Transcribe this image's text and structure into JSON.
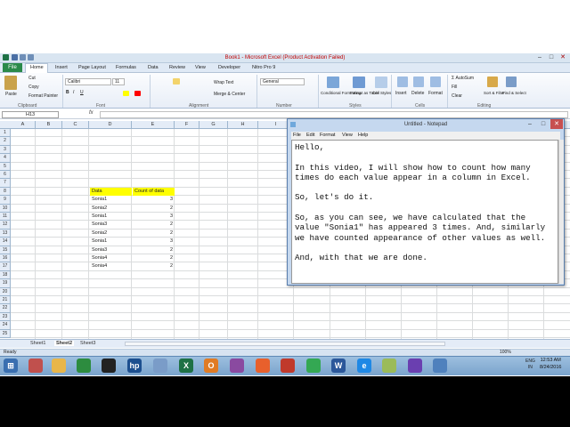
{
  "excel": {
    "title": "Book1 - Microsoft Excel (Product Activation Failed)",
    "tabs": [
      "File",
      "Home",
      "Insert",
      "Page Layout",
      "Formulas",
      "Data",
      "Review",
      "View",
      "Developer",
      "Nitro Pro 9"
    ],
    "ribbon": {
      "paste": "Paste",
      "cut": "Cut",
      "copy": "Copy",
      "format_painter": "Format Painter",
      "font_name": "Calibri",
      "font_size": "11",
      "wrap_text": "Wrap Text",
      "merge_center": "Merge & Center",
      "number_format": "General",
      "conditional_formatting": "Conditional Formatting",
      "format_as_table": "Format as Table",
      "cell_styles": "Cell Styles",
      "insert": "Insert",
      "delete": "Delete",
      "format": "Format",
      "autosum": "AutoSum",
      "fill": "Fill",
      "clear": "Clear",
      "sort_filter": "Sort & Filter",
      "find_select": "Find & Select",
      "groups": {
        "clipboard": "Clipboard",
        "font": "Font",
        "alignment": "Alignment",
        "number": "Number",
        "styles": "Styles",
        "cells": "Cells",
        "editing": "Editing"
      }
    },
    "name_box": "H13",
    "fx": "fx",
    "columns": [
      "A",
      "B",
      "C",
      "D",
      "E",
      "F",
      "G",
      "H",
      "I"
    ],
    "rows": [
      "1",
      "2",
      "3",
      "4",
      "5",
      "6",
      "7",
      "8",
      "9",
      "10",
      "11",
      "12",
      "13",
      "14",
      "15",
      "16",
      "17",
      "18",
      "19",
      "20",
      "21",
      "22",
      "23",
      "24",
      "25"
    ],
    "table": {
      "header": [
        "Data",
        "Count of data"
      ],
      "rows": [
        [
          "Sonia1",
          "3"
        ],
        [
          "Sonia2",
          "2"
        ],
        [
          "Sonia1",
          "3"
        ],
        [
          "Sonia3",
          "2"
        ],
        [
          "Sonia2",
          "2"
        ],
        [
          "Sonia1",
          "3"
        ],
        [
          "Sonia3",
          "2"
        ],
        [
          "Sonia4",
          "2"
        ],
        [
          "Sonia4",
          "2"
        ]
      ]
    },
    "sheets": [
      "Sheet1",
      "Sheet2",
      "Sheet3"
    ],
    "status": "Ready",
    "zoom": "100%",
    "colors": {
      "accent": "#1e7145",
      "header_fill": "#ffff00"
    }
  },
  "notepad": {
    "title": "Untitled - Notepad",
    "menu": [
      "File",
      "Edit",
      "Format",
      "View",
      "Help"
    ],
    "lines": [
      "Hello,",
      "",
      "In this video, I will show how to count how many",
      "times do each value appear in a column in Excel.",
      "",
      "So, let's do it.",
      "",
      "So, as you can see, we have calculated that the",
      "value \"Sonia1\" has appeared 3 times. And, similarly",
      "we have counted appearance of other values as well.",
      "",
      "And, with that we are done."
    ]
  },
  "taskbar": {
    "lang": "ENG",
    "region": "IN",
    "time": "12:53 AM",
    "date": "8/24/2016"
  }
}
